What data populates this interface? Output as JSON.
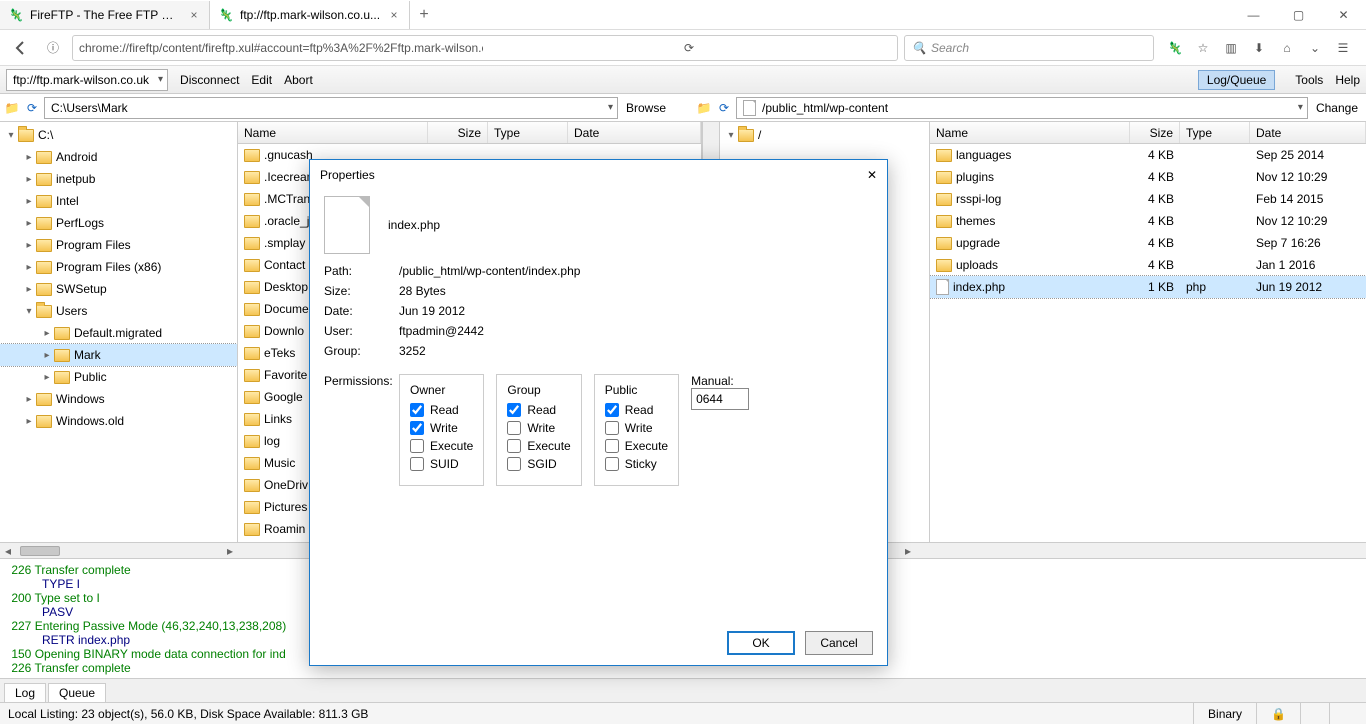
{
  "browser": {
    "tabs": [
      {
        "title": "FireFTP - The Free FTP Cli..."
      },
      {
        "title": "ftp://ftp.mark-wilson.co.u..."
      }
    ],
    "url": "chrome://fireftp/content/fireftp.xul#account=ftp%3A%2F%2Fftp.mark-wilson.co.uk",
    "search_placeholder": "Search"
  },
  "ftp": {
    "account": "ftp://ftp.mark-wilson.co.uk",
    "menu": {
      "disconnect": "Disconnect",
      "edit": "Edit",
      "abort": "Abort"
    },
    "logqueue": "Log/Queue",
    "tools": "Tools",
    "help": "Help",
    "local_path": "C:\\Users\\Mark",
    "remote_path": "/public_html/wp-content",
    "browse": "Browse",
    "change": "Change"
  },
  "columns": {
    "name": "Name",
    "size": "Size",
    "type": "Type",
    "date": "Date"
  },
  "local_tree": [
    {
      "depth": 0,
      "label": "C:\\",
      "open": true
    },
    {
      "depth": 1,
      "label": "Android"
    },
    {
      "depth": 1,
      "label": "inetpub"
    },
    {
      "depth": 1,
      "label": "Intel"
    },
    {
      "depth": 1,
      "label": "PerfLogs"
    },
    {
      "depth": 1,
      "label": "Program Files"
    },
    {
      "depth": 1,
      "label": "Program Files (x86)"
    },
    {
      "depth": 1,
      "label": "SWSetup"
    },
    {
      "depth": 1,
      "label": "Users",
      "open": true
    },
    {
      "depth": 2,
      "label": "Default.migrated"
    },
    {
      "depth": 2,
      "label": "Mark",
      "selected": true
    },
    {
      "depth": 2,
      "label": "Public"
    },
    {
      "depth": 1,
      "label": "Windows"
    },
    {
      "depth": 1,
      "label": "Windows.old"
    }
  ],
  "local_files": [
    ".gnucash",
    ".Icecream",
    ".MCTrans",
    ".oracle_j",
    ".smplay",
    "Contact",
    "Desktop",
    "Docume",
    "Downlo",
    "eTeks",
    "Favorite",
    "Google",
    "Links",
    "log",
    "Music",
    "OneDriv",
    "Pictures",
    "Roamin"
  ],
  "remote_tree": [
    {
      "depth": 0,
      "label": "/",
      "open": true
    }
  ],
  "remote_files": [
    {
      "name": "languages",
      "size": "4 KB",
      "type": "",
      "date": "Sep 25 2014",
      "folder": true
    },
    {
      "name": "plugins",
      "size": "4 KB",
      "type": "",
      "date": "Nov 12 10:29",
      "folder": true
    },
    {
      "name": "rsspi-log",
      "size": "4 KB",
      "type": "",
      "date": "Feb 14 2015",
      "folder": true
    },
    {
      "name": "themes",
      "size": "4 KB",
      "type": "",
      "date": "Nov 12 10:29",
      "folder": true
    },
    {
      "name": "upgrade",
      "size": "4 KB",
      "type": "",
      "date": "Sep 7 16:26",
      "folder": true
    },
    {
      "name": "uploads",
      "size": "4 KB",
      "type": "",
      "date": "Jan 1 2016",
      "folder": true
    },
    {
      "name": "index.php",
      "size": "1 KB",
      "type": "php",
      "date": "Jun 19 2012",
      "folder": false,
      "selected": true
    }
  ],
  "log": [
    {
      "code": "226",
      "msg": "Transfer complete",
      "sub": "TYPE I"
    },
    {
      "code": "200",
      "msg": "Type set to I",
      "sub": "PASV"
    },
    {
      "code": "227",
      "msg": "Entering Passive Mode (46,32,240,13,238,208)",
      "sub": "RETR index.php"
    },
    {
      "code": "150",
      "msg": "Opening BINARY mode data connection for ind"
    },
    {
      "code": "226",
      "msg": "Transfer complete"
    }
  ],
  "bottom_tabs": {
    "log": "Log",
    "queue": "Queue"
  },
  "status": {
    "local": "Local Listing: 23 object(s), 56.0 KB, Disk Space Available: 811.3 GB",
    "binary": "Binary"
  },
  "dialog": {
    "title": "Properties",
    "filename": "index.php",
    "labels": {
      "path": "Path:",
      "size": "Size:",
      "date": "Date:",
      "user": "User:",
      "group": "Group:",
      "permissions": "Permissions:"
    },
    "path": "/public_html/wp-content/index.php",
    "size": "28 Bytes",
    "date": "Jun 19 2012",
    "user": "ftpadmin@2442",
    "group": "3252",
    "perm_headers": {
      "owner": "Owner",
      "group": "Group",
      "public": "Public",
      "manual": "Manual:"
    },
    "perm_labels": {
      "read": "Read",
      "write": "Write",
      "execute": "Execute",
      "suid": "SUID",
      "sgid": "SGID",
      "sticky": "Sticky"
    },
    "perms": {
      "owner": {
        "read": true,
        "write": true,
        "execute": false,
        "extra": false
      },
      "group": {
        "read": true,
        "write": false,
        "execute": false,
        "extra": false
      },
      "public": {
        "read": true,
        "write": false,
        "execute": false,
        "extra": false
      }
    },
    "manual_value": "0644",
    "ok": "OK",
    "cancel": "Cancel"
  }
}
